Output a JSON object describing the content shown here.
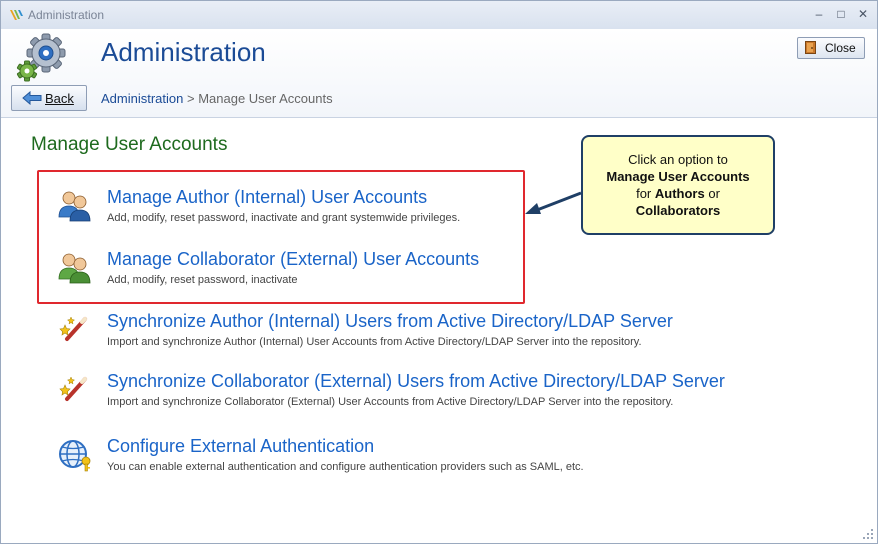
{
  "window": {
    "title": "Administration",
    "controls": {
      "minimize": "–",
      "maximize": "□",
      "close": "✕"
    }
  },
  "header": {
    "icon": "gear-icon",
    "title": "Administration",
    "close_label": "Close",
    "back_label": "Back",
    "breadcrumb": {
      "link": "Administration",
      "separator": " > ",
      "current": "Manage User Accounts"
    }
  },
  "main": {
    "section_title": "Manage User Accounts",
    "options": [
      {
        "title": "Manage Author (Internal) User Accounts",
        "desc": "Add, modify, reset password, inactivate and grant systemwide privileges.",
        "icon": "users-icon"
      },
      {
        "title": "Manage Collaborator (External) User Accounts",
        "desc": "Add, modify, reset password, inactivate",
        "icon": "users-icon"
      },
      {
        "title": "Synchronize Author (Internal) Users from Active Directory/LDAP Server",
        "desc": "Import and synchronize Author (Internal) User Accounts from Active Directory/LDAP Server into the repository.",
        "icon": "magic-wand-icon"
      },
      {
        "title": "Synchronize Collaborator (External) Users from Active Directory/LDAP Server",
        "desc": "Import and synchronize Collaborator (External) User Accounts from Active Directory/LDAP Server into the repository.",
        "icon": "magic-wand-icon"
      },
      {
        "title": "Configure External Authentication",
        "desc": "You can enable external authentication and configure authentication providers such as SAML, etc.",
        "icon": "globe-key-icon"
      }
    ]
  },
  "callout": {
    "line1": "Click an option to",
    "line2": "Manage User Accounts",
    "line3_pre": "for ",
    "line3_bold": "Authors",
    "line3_post": " or",
    "line4": "Collaborators"
  },
  "colors": {
    "accent": "#1a64c8",
    "section_title": "#1e6a1e",
    "highlight": "#e0282e",
    "callout_bg": "#ffffc8"
  }
}
